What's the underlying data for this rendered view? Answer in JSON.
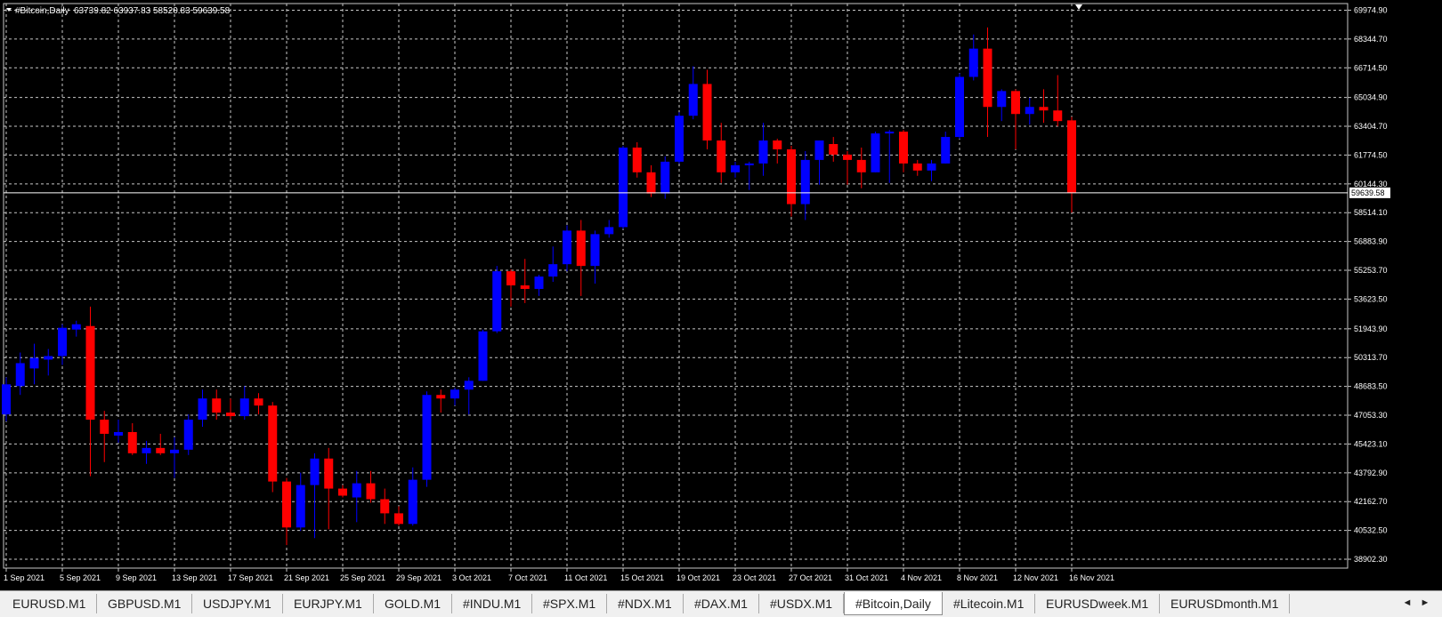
{
  "chart_data": {
    "type": "candlestick",
    "title": "#Bitcoin,Daily",
    "ohlc_readout": "63739.82 63937.83 58520.83 59639.58",
    "current_price": 59639.58,
    "current_price_label": "59639.58",
    "y_ticks": [
      "69974.90",
      "68344.70",
      "66714.50",
      "65034.90",
      "63404.70",
      "61774.50",
      "60144.30",
      "58514.10",
      "56883.90",
      "55253.70",
      "53623.50",
      "51943.90",
      "50313.70",
      "48683.50",
      "47053.30",
      "45423.10",
      "43792.90",
      "42162.70",
      "40532.50",
      "38902.30"
    ],
    "ylim": [
      38400,
      70350
    ],
    "x_tick_labels": [
      "1 Sep 2021",
      "5 Sep 2021",
      "9 Sep 2021",
      "13 Sep 2021",
      "17 Sep 2021",
      "21 Sep 2021",
      "25 Sep 2021",
      "29 Sep 2021",
      "3 Oct 2021",
      "7 Oct 2021",
      "11 Oct 2021",
      "15 Oct 2021",
      "19 Oct 2021",
      "23 Oct 2021",
      "27 Oct 2021",
      "31 Oct 2021",
      "4 Nov 2021",
      "8 Nov 2021",
      "12 Nov 2021",
      "16 Nov 2021"
    ],
    "bull_color": "#0000ff",
    "bear_color": "#ff0000",
    "candles": [
      {
        "open": 47100,
        "high": 49200,
        "low": 46700,
        "close": 48800
      },
      {
        "open": 48700,
        "high": 50600,
        "low": 48200,
        "close": 50000
      },
      {
        "open": 49700,
        "high": 51100,
        "low": 48800,
        "close": 50300
      },
      {
        "open": 50200,
        "high": 50800,
        "low": 49300,
        "close": 50400
      },
      {
        "open": 50400,
        "high": 52200,
        "low": 49900,
        "close": 52000
      },
      {
        "open": 51900,
        "high": 52400,
        "low": 51500,
        "close": 52200
      },
      {
        "open": 52100,
        "high": 53200,
        "low": 43600,
        "close": 46800
      },
      {
        "open": 46800,
        "high": 47300,
        "low": 44400,
        "close": 46000
      },
      {
        "open": 45900,
        "high": 46800,
        "low": 45500,
        "close": 46100
      },
      {
        "open": 46100,
        "high": 46600,
        "low": 44800,
        "close": 44900
      },
      {
        "open": 44900,
        "high": 45600,
        "low": 44300,
        "close": 45200
      },
      {
        "open": 45200,
        "high": 46000,
        "low": 44800,
        "close": 44900
      },
      {
        "open": 44900,
        "high": 45800,
        "low": 43500,
        "close": 45100
      },
      {
        "open": 45100,
        "high": 47100,
        "low": 44800,
        "close": 46800
      },
      {
        "open": 46800,
        "high": 48500,
        "low": 46400,
        "close": 48000
      },
      {
        "open": 48000,
        "high": 48500,
        "low": 46800,
        "close": 47200
      },
      {
        "open": 47200,
        "high": 48000,
        "low": 46800,
        "close": 47000
      },
      {
        "open": 47000,
        "high": 48700,
        "low": 46800,
        "close": 48000
      },
      {
        "open": 48000,
        "high": 48300,
        "low": 47100,
        "close": 47600
      },
      {
        "open": 47600,
        "high": 47800,
        "low": 42700,
        "close": 43300
      },
      {
        "open": 43300,
        "high": 43500,
        "low": 39700,
        "close": 40700
      },
      {
        "open": 40700,
        "high": 43800,
        "low": 40500,
        "close": 43100
      },
      {
        "open": 43100,
        "high": 44900,
        "low": 40100,
        "close": 44600
      },
      {
        "open": 44600,
        "high": 45200,
        "low": 40600,
        "close": 42900
      },
      {
        "open": 42900,
        "high": 43100,
        "low": 42400,
        "close": 42500
      },
      {
        "open": 42400,
        "high": 43900,
        "low": 41000,
        "close": 43200
      },
      {
        "open": 43200,
        "high": 43900,
        "low": 42100,
        "close": 42300
      },
      {
        "open": 42300,
        "high": 42900,
        "low": 40900,
        "close": 41500
      },
      {
        "open": 41500,
        "high": 41900,
        "low": 40800,
        "close": 40900
      },
      {
        "open": 40900,
        "high": 44100,
        "low": 40800,
        "close": 43400
      },
      {
        "open": 43400,
        "high": 48400,
        "low": 43000,
        "close": 48200
      },
      {
        "open": 48200,
        "high": 48500,
        "low": 47200,
        "close": 48000
      },
      {
        "open": 48000,
        "high": 48600,
        "low": 47600,
        "close": 48500
      },
      {
        "open": 48500,
        "high": 49200,
        "low": 47100,
        "close": 49000
      },
      {
        "open": 49000,
        "high": 51900,
        "low": 49000,
        "close": 51800
      },
      {
        "open": 51800,
        "high": 55500,
        "low": 51700,
        "close": 55200
      },
      {
        "open": 55200,
        "high": 55300,
        "low": 53200,
        "close": 54400
      },
      {
        "open": 54400,
        "high": 55900,
        "low": 53400,
        "close": 54200
      },
      {
        "open": 54200,
        "high": 55000,
        "low": 53800,
        "close": 54900
      },
      {
        "open": 54900,
        "high": 56600,
        "low": 54600,
        "close": 55600
      },
      {
        "open": 55600,
        "high": 57800,
        "low": 55200,
        "close": 57500
      },
      {
        "open": 57500,
        "high": 58100,
        "low": 53800,
        "close": 55500
      },
      {
        "open": 55500,
        "high": 57500,
        "low": 54500,
        "close": 57300
      },
      {
        "open": 57300,
        "high": 58100,
        "low": 57100,
        "close": 57700
      },
      {
        "open": 57700,
        "high": 62300,
        "low": 57600,
        "close": 62200
      },
      {
        "open": 62200,
        "high": 62500,
        "low": 60500,
        "close": 60800
      },
      {
        "open": 60800,
        "high": 61200,
        "low": 59400,
        "close": 59600
      },
      {
        "open": 59600,
        "high": 61700,
        "low": 59300,
        "close": 61400
      },
      {
        "open": 61400,
        "high": 64200,
        "low": 61300,
        "close": 64000
      },
      {
        "open": 64000,
        "high": 66800,
        "low": 63800,
        "close": 65800
      },
      {
        "open": 65800,
        "high": 66600,
        "low": 62100,
        "close": 62600
      },
      {
        "open": 62600,
        "high": 63600,
        "low": 60200,
        "close": 60800
      },
      {
        "open": 60800,
        "high": 61400,
        "low": 60500,
        "close": 61200
      },
      {
        "open": 61200,
        "high": 61400,
        "low": 59800,
        "close": 61300
      },
      {
        "open": 61300,
        "high": 63600,
        "low": 60600,
        "close": 62600
      },
      {
        "open": 62600,
        "high": 62700,
        "low": 61300,
        "close": 62100
      },
      {
        "open": 62100,
        "high": 62300,
        "low": 58300,
        "close": 59000
      },
      {
        "open": 59000,
        "high": 62000,
        "low": 58100,
        "close": 61500
      },
      {
        "open": 61500,
        "high": 62600,
        "low": 60100,
        "close": 62600
      },
      {
        "open": 62400,
        "high": 62800,
        "low": 61400,
        "close": 61800
      },
      {
        "open": 61800,
        "high": 62000,
        "low": 60100,
        "close": 61500
      },
      {
        "open": 61500,
        "high": 62200,
        "low": 59900,
        "close": 60800
      },
      {
        "open": 60800,
        "high": 63100,
        "low": 60800,
        "close": 63000
      },
      {
        "open": 63000,
        "high": 63200,
        "low": 60200,
        "close": 63100
      },
      {
        "open": 63100,
        "high": 63200,
        "low": 60800,
        "close": 61300
      },
      {
        "open": 61300,
        "high": 61500,
        "low": 60600,
        "close": 60900
      },
      {
        "open": 60900,
        "high": 61500,
        "low": 60300,
        "close": 61300
      },
      {
        "open": 61300,
        "high": 63100,
        "low": 61300,
        "close": 62800
      },
      {
        "open": 62800,
        "high": 66400,
        "low": 62700,
        "close": 66200
      },
      {
        "open": 66200,
        "high": 68600,
        "low": 66000,
        "close": 67800
      },
      {
        "open": 67800,
        "high": 69000,
        "low": 62800,
        "close": 64500
      },
      {
        "open": 64500,
        "high": 65500,
        "low": 63700,
        "close": 65400
      },
      {
        "open": 65400,
        "high": 65500,
        "low": 62100,
        "close": 64100
      },
      {
        "open": 64100,
        "high": 65000,
        "low": 63500,
        "close": 64500
      },
      {
        "open": 64500,
        "high": 65500,
        "low": 63600,
        "close": 64300
      },
      {
        "open": 64300,
        "high": 66300,
        "low": 63400,
        "close": 63700
      },
      {
        "open": 63739.82,
        "high": 63937.83,
        "low": 58520.83,
        "close": 59639.58
      }
    ]
  },
  "tabs": [
    {
      "label": "EURUSD.M1",
      "active": false
    },
    {
      "label": "GBPUSD.M1",
      "active": false
    },
    {
      "label": "USDJPY.M1",
      "active": false
    },
    {
      "label": "EURJPY.M1",
      "active": false
    },
    {
      "label": "GOLD.M1",
      "active": false
    },
    {
      "label": "#INDU.M1",
      "active": false
    },
    {
      "label": "#SPX.M1",
      "active": false
    },
    {
      "label": "#NDX.M1",
      "active": false
    },
    {
      "label": "#DAX.M1",
      "active": false
    },
    {
      "label": "#USDX.M1",
      "active": false
    },
    {
      "label": "#Bitcoin,Daily",
      "active": true
    },
    {
      "label": "#Litecoin.M1",
      "active": false
    },
    {
      "label": "EURUSDweek.M1",
      "active": false
    },
    {
      "label": "EURUSDmonth.M1",
      "active": false
    }
  ],
  "nav": {
    "left": "◄",
    "right": "►"
  }
}
